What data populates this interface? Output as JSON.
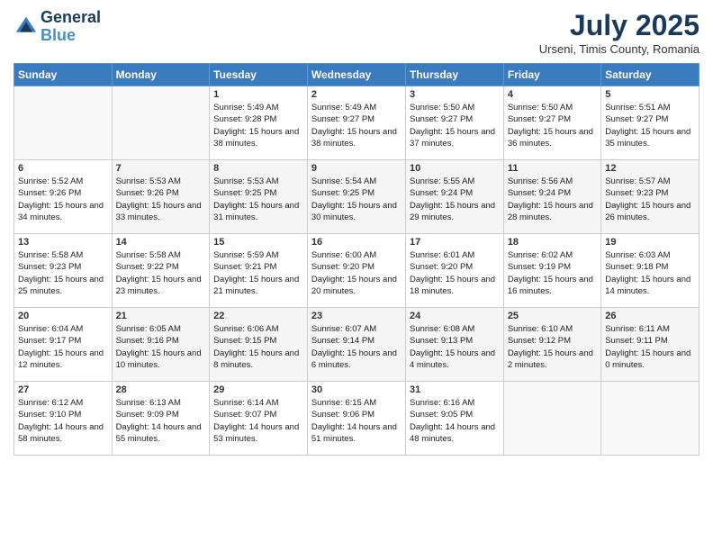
{
  "header": {
    "logo_blue": "Blue",
    "month_title": "July 2025",
    "location": "Urseni, Timis County, Romania"
  },
  "calendar": {
    "days": [
      "Sunday",
      "Monday",
      "Tuesday",
      "Wednesday",
      "Thursday",
      "Friday",
      "Saturday"
    ],
    "weeks": [
      [
        {
          "num": "",
          "info": ""
        },
        {
          "num": "",
          "info": ""
        },
        {
          "num": "1",
          "info": "Sunrise: 5:49 AM\nSunset: 9:28 PM\nDaylight: 15 hours and 38 minutes."
        },
        {
          "num": "2",
          "info": "Sunrise: 5:49 AM\nSunset: 9:27 PM\nDaylight: 15 hours and 38 minutes."
        },
        {
          "num": "3",
          "info": "Sunrise: 5:50 AM\nSunset: 9:27 PM\nDaylight: 15 hours and 37 minutes."
        },
        {
          "num": "4",
          "info": "Sunrise: 5:50 AM\nSunset: 9:27 PM\nDaylight: 15 hours and 36 minutes."
        },
        {
          "num": "5",
          "info": "Sunrise: 5:51 AM\nSunset: 9:27 PM\nDaylight: 15 hours and 35 minutes."
        }
      ],
      [
        {
          "num": "6",
          "info": "Sunrise: 5:52 AM\nSunset: 9:26 PM\nDaylight: 15 hours and 34 minutes."
        },
        {
          "num": "7",
          "info": "Sunrise: 5:53 AM\nSunset: 9:26 PM\nDaylight: 15 hours and 33 minutes."
        },
        {
          "num": "8",
          "info": "Sunrise: 5:53 AM\nSunset: 9:25 PM\nDaylight: 15 hours and 31 minutes."
        },
        {
          "num": "9",
          "info": "Sunrise: 5:54 AM\nSunset: 9:25 PM\nDaylight: 15 hours and 30 minutes."
        },
        {
          "num": "10",
          "info": "Sunrise: 5:55 AM\nSunset: 9:24 PM\nDaylight: 15 hours and 29 minutes."
        },
        {
          "num": "11",
          "info": "Sunrise: 5:56 AM\nSunset: 9:24 PM\nDaylight: 15 hours and 28 minutes."
        },
        {
          "num": "12",
          "info": "Sunrise: 5:57 AM\nSunset: 9:23 PM\nDaylight: 15 hours and 26 minutes."
        }
      ],
      [
        {
          "num": "13",
          "info": "Sunrise: 5:58 AM\nSunset: 9:23 PM\nDaylight: 15 hours and 25 minutes."
        },
        {
          "num": "14",
          "info": "Sunrise: 5:58 AM\nSunset: 9:22 PM\nDaylight: 15 hours and 23 minutes."
        },
        {
          "num": "15",
          "info": "Sunrise: 5:59 AM\nSunset: 9:21 PM\nDaylight: 15 hours and 21 minutes."
        },
        {
          "num": "16",
          "info": "Sunrise: 6:00 AM\nSunset: 9:20 PM\nDaylight: 15 hours and 20 minutes."
        },
        {
          "num": "17",
          "info": "Sunrise: 6:01 AM\nSunset: 9:20 PM\nDaylight: 15 hours and 18 minutes."
        },
        {
          "num": "18",
          "info": "Sunrise: 6:02 AM\nSunset: 9:19 PM\nDaylight: 15 hours and 16 minutes."
        },
        {
          "num": "19",
          "info": "Sunrise: 6:03 AM\nSunset: 9:18 PM\nDaylight: 15 hours and 14 minutes."
        }
      ],
      [
        {
          "num": "20",
          "info": "Sunrise: 6:04 AM\nSunset: 9:17 PM\nDaylight: 15 hours and 12 minutes."
        },
        {
          "num": "21",
          "info": "Sunrise: 6:05 AM\nSunset: 9:16 PM\nDaylight: 15 hours and 10 minutes."
        },
        {
          "num": "22",
          "info": "Sunrise: 6:06 AM\nSunset: 9:15 PM\nDaylight: 15 hours and 8 minutes."
        },
        {
          "num": "23",
          "info": "Sunrise: 6:07 AM\nSunset: 9:14 PM\nDaylight: 15 hours and 6 minutes."
        },
        {
          "num": "24",
          "info": "Sunrise: 6:08 AM\nSunset: 9:13 PM\nDaylight: 15 hours and 4 minutes."
        },
        {
          "num": "25",
          "info": "Sunrise: 6:10 AM\nSunset: 9:12 PM\nDaylight: 15 hours and 2 minutes."
        },
        {
          "num": "26",
          "info": "Sunrise: 6:11 AM\nSunset: 9:11 PM\nDaylight: 15 hours and 0 minutes."
        }
      ],
      [
        {
          "num": "27",
          "info": "Sunrise: 6:12 AM\nSunset: 9:10 PM\nDaylight: 14 hours and 58 minutes."
        },
        {
          "num": "28",
          "info": "Sunrise: 6:13 AM\nSunset: 9:09 PM\nDaylight: 14 hours and 55 minutes."
        },
        {
          "num": "29",
          "info": "Sunrise: 6:14 AM\nSunset: 9:07 PM\nDaylight: 14 hours and 53 minutes."
        },
        {
          "num": "30",
          "info": "Sunrise: 6:15 AM\nSunset: 9:06 PM\nDaylight: 14 hours and 51 minutes."
        },
        {
          "num": "31",
          "info": "Sunrise: 6:16 AM\nSunset: 9:05 PM\nDaylight: 14 hours and 48 minutes."
        },
        {
          "num": "",
          "info": ""
        },
        {
          "num": "",
          "info": ""
        }
      ]
    ]
  }
}
